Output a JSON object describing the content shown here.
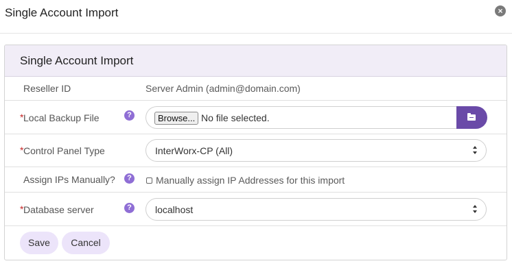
{
  "modal": {
    "title": "Single Account Import",
    "close_icon": "close-icon"
  },
  "panel": {
    "title": "Single Account Import"
  },
  "form": {
    "reseller": {
      "label": "Reseller ID",
      "value": "Server Admin (admin@domain.com)"
    },
    "backup": {
      "required_mark": "*",
      "label": "Local Backup File",
      "help": "?",
      "browse_label": "Browse...",
      "status": "No file selected.",
      "folder_icon": "folder-icon"
    },
    "control_panel": {
      "required_mark": "*",
      "label": "Control Panel Type",
      "help": "?",
      "selected": "InterWorx-CP (All)"
    },
    "assign_ips": {
      "label": "Assign IPs Manually?",
      "help": "?",
      "checkbox_label": "Manually assign IP Addresses for this import",
      "checked": false
    },
    "database": {
      "required_mark": "*",
      "label": "Database server",
      "help": "?",
      "selected": "localhost"
    }
  },
  "actions": {
    "save_label": "Save",
    "cancel_label": "Cancel"
  },
  "colors": {
    "accent": "#6a4aa8",
    "help_badge": "#8f6ed5",
    "panel_header_bg": "#f1edf7",
    "button_bg": "#ece4fa",
    "required": "#c62828"
  }
}
